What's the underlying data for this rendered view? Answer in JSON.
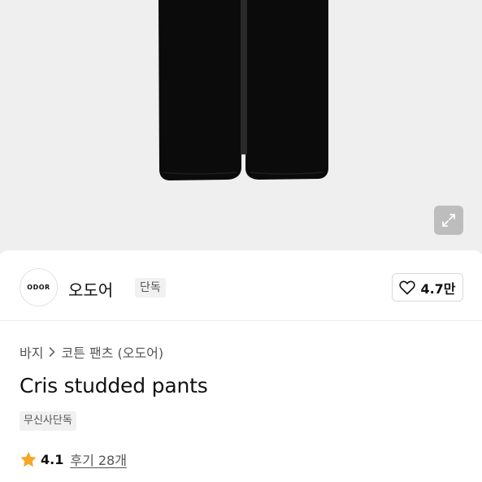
{
  "colors": {
    "hero_background": "#efefef",
    "pants": "#0b0b0b",
    "star": "#f5a623",
    "badge_background": "#f1f1f1"
  },
  "hero": {
    "expand_icon": "expand-icon"
  },
  "brand": {
    "logo_text": "ODOR",
    "name": "오도어",
    "badge": "단독",
    "like_icon": "heart-outline-icon",
    "like_count": "4.7만"
  },
  "breadcrumb": {
    "category": "바지",
    "separator_icon": "chevron-right-icon",
    "subcategory": "코튼 팬츠 (오도어)"
  },
  "product": {
    "title": "Cris studded pants",
    "tag": "무신사단독"
  },
  "rating": {
    "icon": "star-icon",
    "value": "4.1",
    "reviews_label": "후기 28개"
  }
}
